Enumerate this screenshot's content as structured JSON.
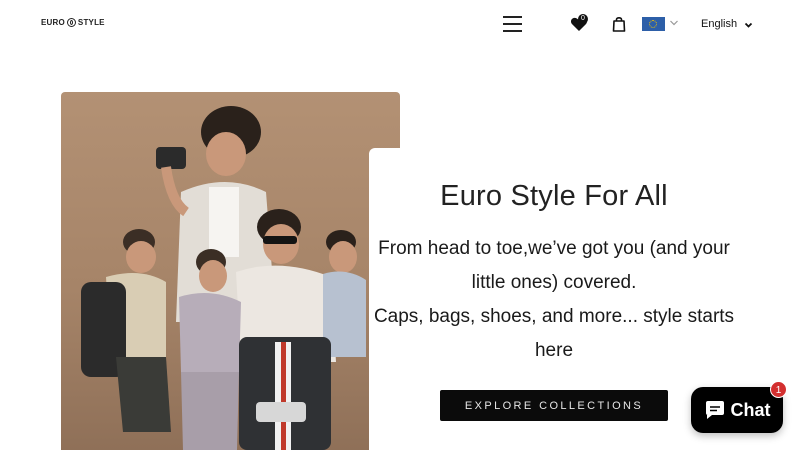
{
  "header": {
    "logo": {
      "left": "EURO",
      "right": "STYLE"
    },
    "wishlist_count": "0",
    "language": "English",
    "icons": {
      "menu": "hamburger-menu-icon",
      "wishlist": "heart-icon",
      "cart": "shopping-bag-icon",
      "country": "eu-flag-icon",
      "caret": "chevron-down-icon"
    }
  },
  "hero": {
    "title": "Euro Style For All",
    "line1": "From head to toe,we’ve got you (and your little ones) covered.",
    "line2": "Caps, bags, shoes, and more... style starts here",
    "cta_label": "EXPLORE COLLECTIONS"
  },
  "chat": {
    "label": "Chat",
    "badge": "1",
    "icon": "chat-bubble-icon"
  },
  "colors": {
    "cta_bg": "#0b0b0b",
    "flag_blue": "#2d5fa8",
    "badge_red": "#d32f2f"
  }
}
